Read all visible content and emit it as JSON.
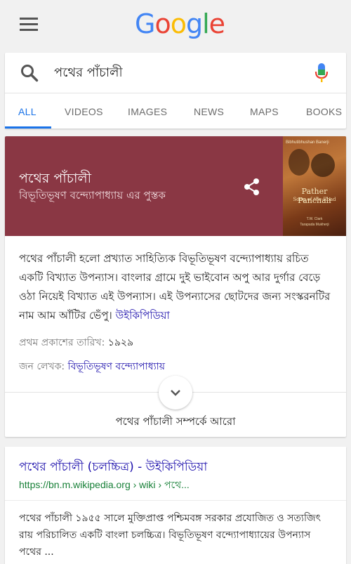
{
  "logo": {
    "letters": [
      "G",
      "o",
      "o",
      "g",
      "l",
      "e"
    ],
    "colors": [
      "#4285F4",
      "#EA4335",
      "#FBBC05",
      "#4285F4",
      "#34A853",
      "#EA4335"
    ]
  },
  "search": {
    "query": "পথের পাঁচালী"
  },
  "tabs": [
    {
      "label": "ALL",
      "active": true
    },
    {
      "label": "VIDEOS",
      "active": false
    },
    {
      "label": "IMAGES",
      "active": false
    },
    {
      "label": "NEWS",
      "active": false
    },
    {
      "label": "MAPS",
      "active": false
    },
    {
      "label": "BOOKS",
      "active": false
    }
  ],
  "knowledge_panel": {
    "title": "পথের পাঁচালী",
    "subtitle": "বিভূতিভূষণ বন্দ্যোপাধ্যায় এর পুস্তক",
    "header_color": "#8a3744",
    "cover": {
      "author": "Bibhutibhushan Banerji",
      "title": "Pather Panchali",
      "subtitle": "Song of the Road",
      "translators": "T.W. Clark\nTarapada Mukherji"
    },
    "description": "পথের পাঁচালী হলো প্রখ্যাত সাহিত্যিক বিভূতিভূষণ বন্দ্যোপাধ্যায় রচিত একটি বিখ্যাত উপন্যাস। বাংলার গ্রামে দুই ভাইবোন অপু আর দুর্গার বেড়ে ওঠা নিয়েই বিখ্যাত এই উপন্যাস। এই উপন্যাসের ছোটদের জন্য সংস্করনটির নাম আম আঁটির ভেঁপু।",
    "source_link": "উইকিপিডিয়া",
    "facts": [
      {
        "key": "প্রথম প্রকাশের তারিখ:",
        "value": "১৯২৯",
        "is_link": false
      },
      {
        "key": "জন লেখক:",
        "value": "বিভূতিভূষণ বন্দ্যোপাধ্যায়",
        "is_link": true
      }
    ],
    "more_label": "পথের পাঁচালী সম্পর্কে আরো"
  },
  "result": {
    "title": "পথের পাঁচালী (চলচ্চিত্র) - উইকিপিডিয়া",
    "url": "https://bn.m.wikipedia.org › wiki › পথে...",
    "snippet": "পথের পাঁচালী ১৯৫৫ সালে মুক্তিপ্রাপ্ত পশ্চিমবঙ্গ সরকার প্রযোজিত ও সত্যজিৎ রায় পরিচালিত একটি বাংলা চলচ্চিত্র। বিভূতিভূষণ বন্দ্যোপাধ্যায়ের উপন্যাস পথের ..."
  }
}
